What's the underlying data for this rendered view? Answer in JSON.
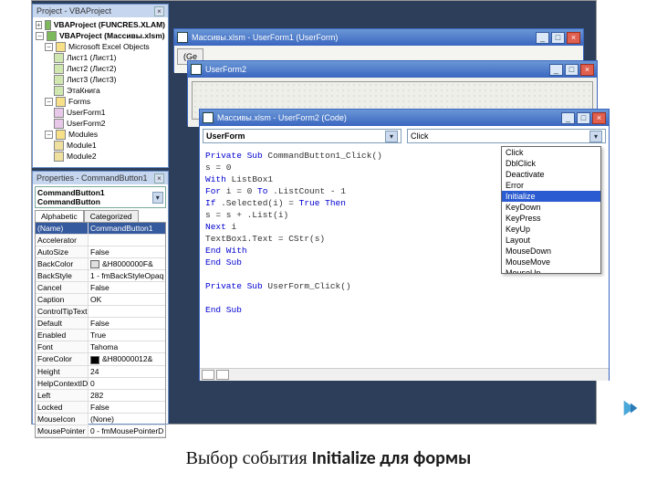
{
  "caption": {
    "pre": "Выбор события ",
    "em": "Initialize для формы"
  },
  "projectExplorer": {
    "title": "Project - VBAProject",
    "root1": "VBAProject (FUNCRES.XLAM)",
    "root2": "VBAProject (Массивы.xlsm)",
    "folder_objects": "Microsoft Excel Objects",
    "sheet1": "Лист1 (Лист1)",
    "sheet2": "Лист2 (Лист2)",
    "sheet3": "Лист3 (Лист3)",
    "workbook": "ЭтаКнига",
    "folder_forms": "Forms",
    "form1": "UserForm1",
    "form2": "UserForm2",
    "folder_modules": "Modules",
    "module1": "Module1",
    "module2": "Module2"
  },
  "properties": {
    "title": "Properties - CommandButton1",
    "object": "CommandButton1 CommandButton",
    "tab_alpha": "Alphabetic",
    "tab_cat": "Categorized",
    "hdr_name": "(Name)",
    "rows": [
      {
        "k": "(Name)",
        "v": "CommandButton1"
      },
      {
        "k": "Accelerator",
        "v": ""
      },
      {
        "k": "AutoSize",
        "v": "False"
      },
      {
        "k": "BackColor",
        "v": "&H8000000F&",
        "sw": "#e0e0e0"
      },
      {
        "k": "BackStyle",
        "v": "1 - fmBackStyleOpaq"
      },
      {
        "k": "Cancel",
        "v": "False"
      },
      {
        "k": "Caption",
        "v": "OK"
      },
      {
        "k": "ControlTipText",
        "v": ""
      },
      {
        "k": "Default",
        "v": "False"
      },
      {
        "k": "Enabled",
        "v": "True"
      },
      {
        "k": "Font",
        "v": "Tahoma"
      },
      {
        "k": "ForeColor",
        "v": "&H80000012&",
        "sw": "#000000"
      },
      {
        "k": "Height",
        "v": "24"
      },
      {
        "k": "HelpContextID",
        "v": "0"
      },
      {
        "k": "Left",
        "v": "282"
      },
      {
        "k": "Locked",
        "v": "False"
      },
      {
        "k": "MouseIcon",
        "v": "(None)"
      },
      {
        "k": "MousePointer",
        "v": "0 - fmMousePointerD"
      }
    ]
  },
  "win1": {
    "title": "Массивы.xlsm - UserForm1 (UserForm)",
    "label": "(Ge"
  },
  "win2": {
    "title": "UserForm2"
  },
  "win3": {
    "title": "Массивы.xlsm - UserForm2 (Code)",
    "object_dd": "UserForm",
    "event_dd": "Click",
    "events": [
      "Click",
      "DblClick",
      "Deactivate",
      "Error",
      "Initialize",
      "KeyDown",
      "KeyPress",
      "KeyUp",
      "Layout",
      "MouseDown",
      "MouseMove",
      "MouseUp"
    ],
    "code": {
      "l1a": "Private Sub",
      "l1b": " CommandButton1_Click()",
      "l2": "s = 0",
      "l3a": "With",
      "l3b": " ListBox1",
      "l4a": "For",
      "l4b": " i = 0 ",
      "l4c": "To",
      "l4d": " .ListCount - 1",
      "l5a": "If",
      "l5b": " .Selected(i) = ",
      "l5c": "True Then",
      "l6": "s = s + .List(i)",
      "l7a": "Next",
      "l7b": " i",
      "l8": "TextBox1.Text = CStr(s)",
      "l9": "End With",
      "l10": "End Sub",
      "l11a": "Private Sub",
      "l11b": " UserForm_Click()",
      "l12": "End Sub"
    }
  }
}
